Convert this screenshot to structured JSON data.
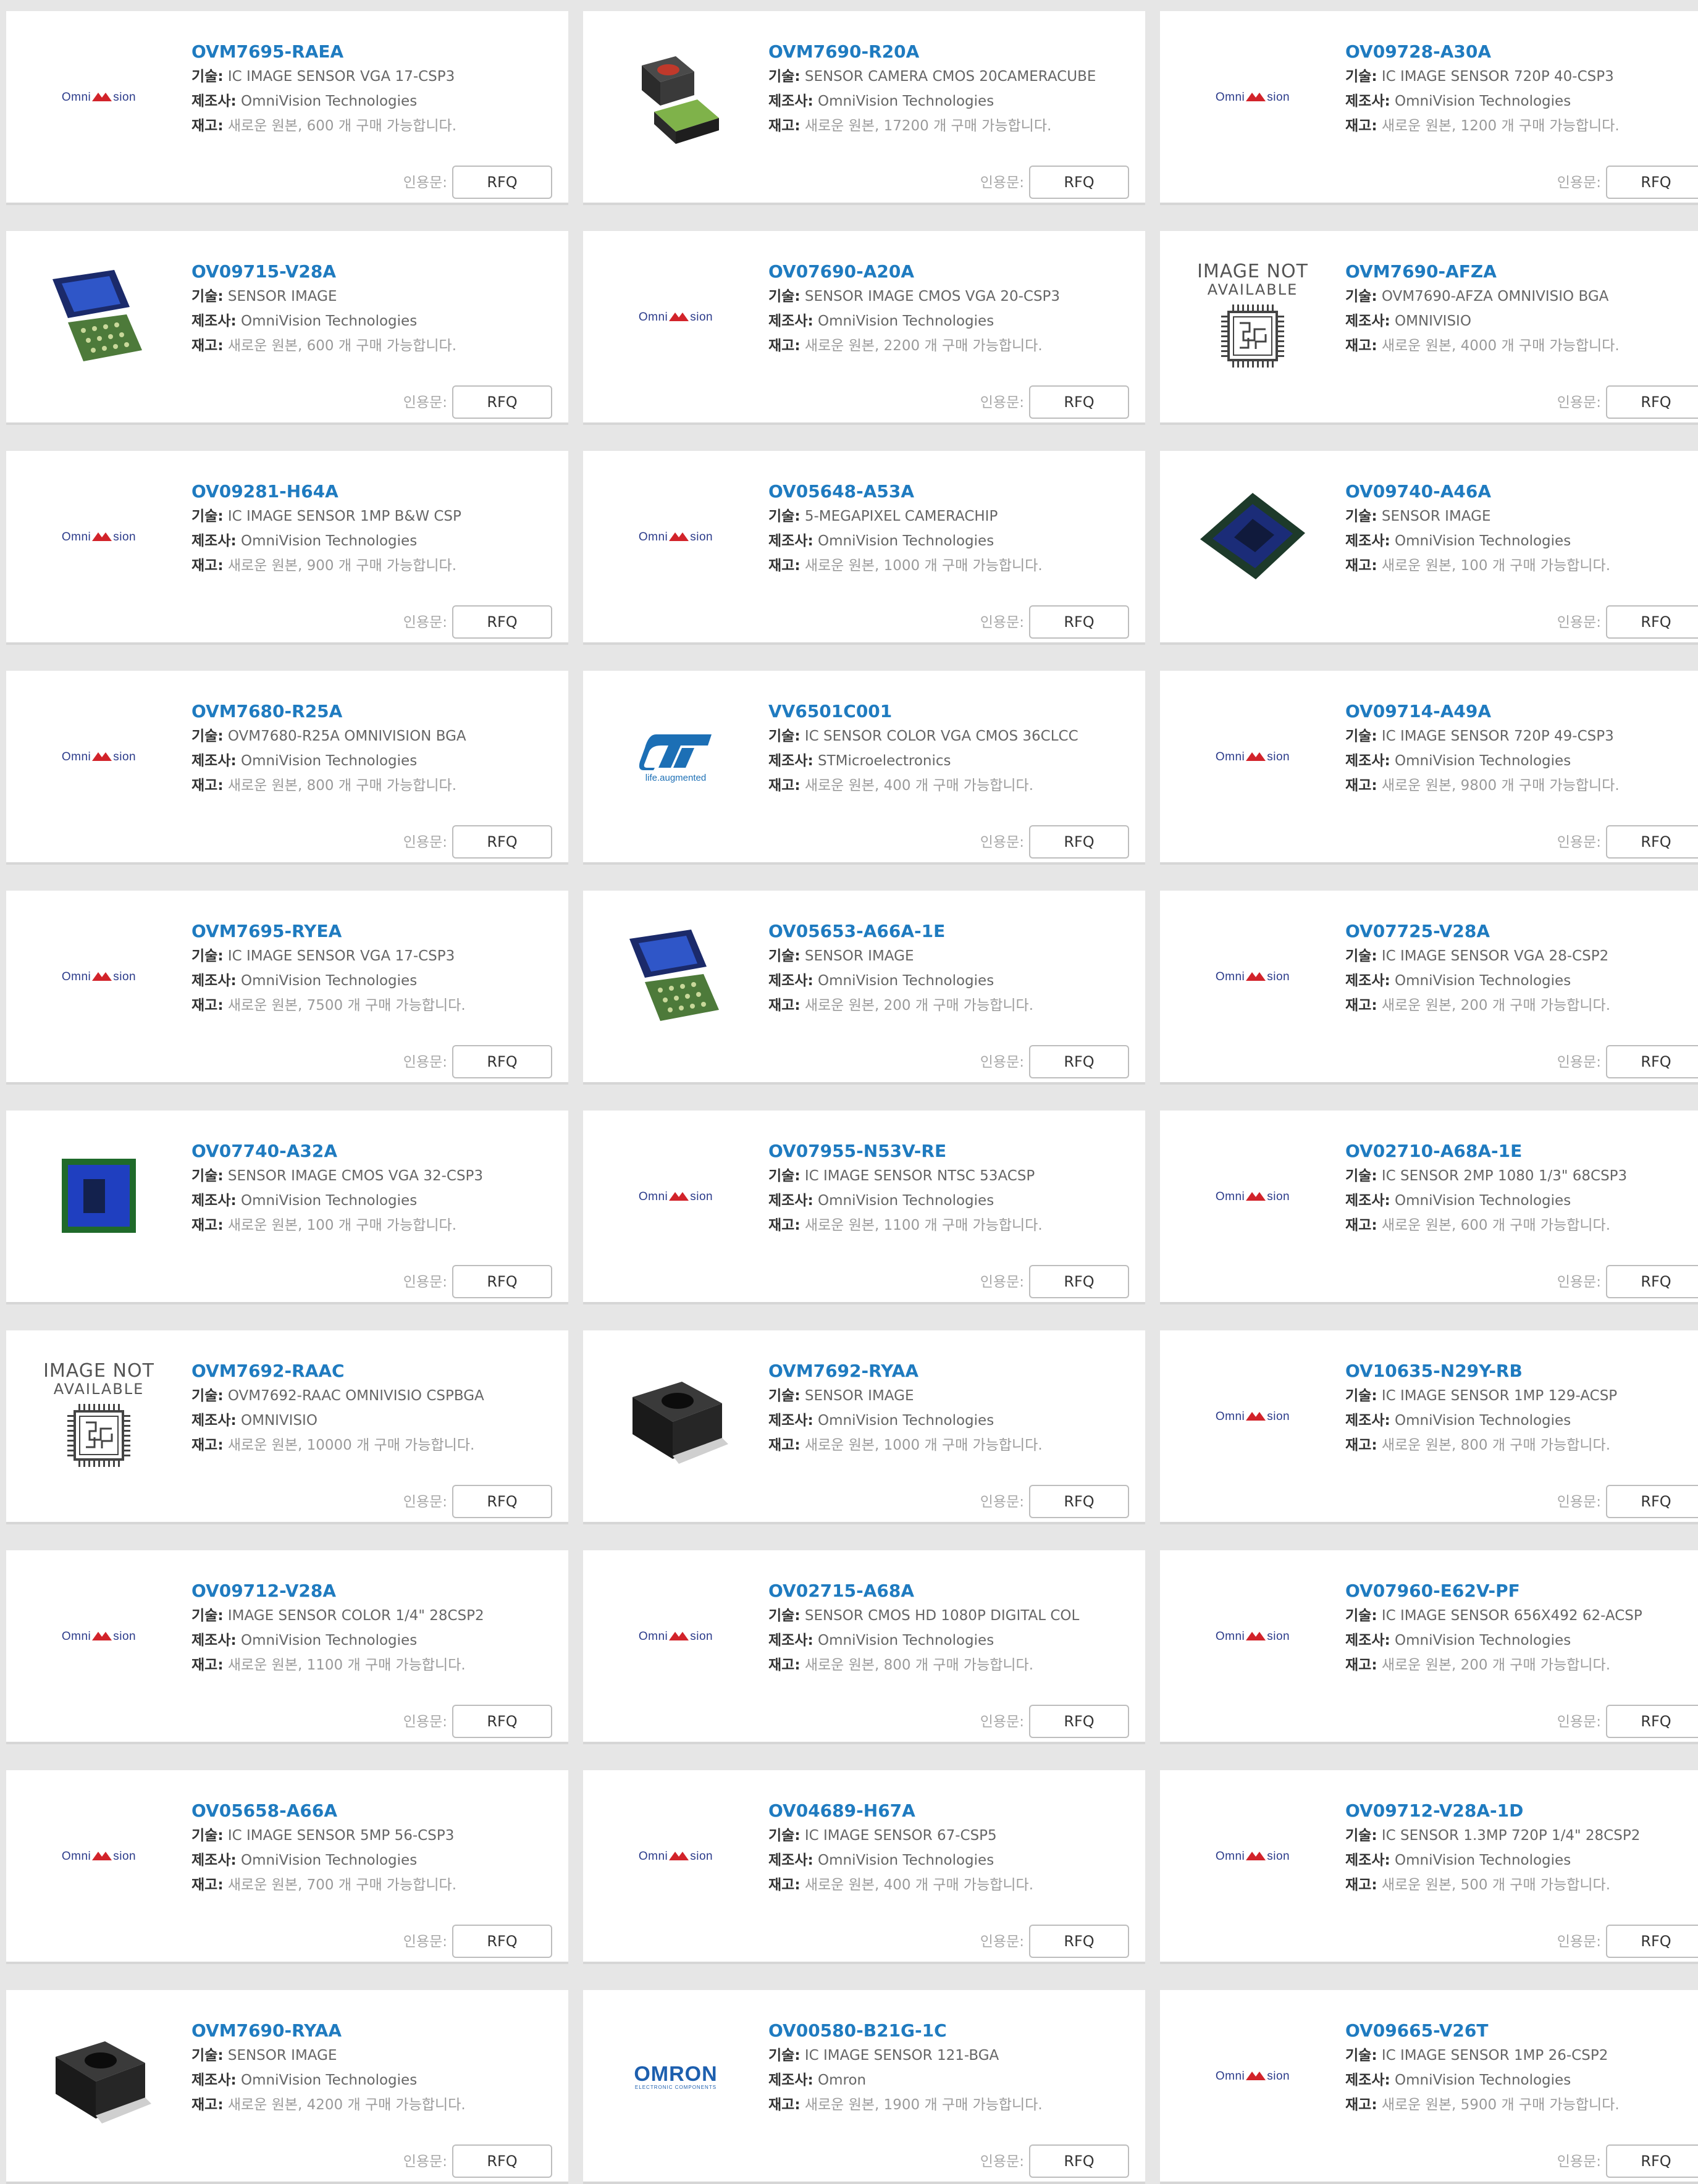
{
  "labels": {
    "tech": "기술:",
    "maker": "제조사:",
    "stock": "재고:",
    "quote": "인용문:",
    "rfq": "RFQ",
    "stock_prefix": "새로운 원본,",
    "stock_suffix": "개 구매 가능합니다.",
    "image_not_available_1": "IMAGE NOT",
    "image_not_available_2": "AVAILABLE",
    "st_tagline": "life.augmented",
    "omron_main": "OMRON",
    "omron_sub": "ELECTRONIC COMPONENTS",
    "omnivision_logo": "OmniVision"
  },
  "products": [
    {
      "part": "OVM7695-RAEA",
      "tech": "IC IMAGE SENSOR VGA 17-CSP3",
      "maker": "OmniVision Technologies",
      "qty": "600",
      "image": "omnivision-logo"
    },
    {
      "part": "OVM7690-R20A",
      "tech": "SENSOR CAMERA CMOS 20CAMERACUBE",
      "maker": "OmniVision Technologies",
      "qty": "17200",
      "image": "camera-cube-chip"
    },
    {
      "part": "OV09728-A30A",
      "tech": "IC IMAGE SENSOR 720P 40-CSP3",
      "maker": "OmniVision Technologies",
      "qty": "1200",
      "image": "omnivision-logo"
    },
    {
      "part": "OV09715-V28A",
      "tech": "SENSOR IMAGE",
      "maker": "OmniVision Technologies",
      "qty": "600",
      "image": "sensor-bga-pair"
    },
    {
      "part": "OV07690-A20A",
      "tech": "SENSOR IMAGE CMOS VGA 20-CSP3",
      "maker": "OmniVision Technologies",
      "qty": "2200",
      "image": "omnivision-logo"
    },
    {
      "part": "OVM7690-AFZA",
      "tech": "OVM7690-AFZA OMNIVISIO BGA",
      "maker": "OMNIVISIO",
      "qty": "4000",
      "image": "image-not-available"
    },
    {
      "part": "OV09281-H64A",
      "tech": "IC IMAGE SENSOR 1MP B&W CSP",
      "maker": "OmniVision Technologies",
      "qty": "900",
      "image": "omnivision-logo"
    },
    {
      "part": "OV05648-A53A",
      "tech": "5-MEGAPIXEL CAMERACHIP",
      "maker": "OmniVision Technologies",
      "qty": "1000",
      "image": "omnivision-logo"
    },
    {
      "part": "OV09740-A46A",
      "tech": "SENSOR IMAGE",
      "maker": "OmniVision Technologies",
      "qty": "100",
      "image": "sensor-diamond"
    },
    {
      "part": "OVM7680-R25A",
      "tech": "OVM7680-R25A OMNIVISION BGA",
      "maker": "OmniVision Technologies",
      "qty": "800",
      "image": "omnivision-logo"
    },
    {
      "part": "VV6501C001",
      "tech": "IC SENSOR COLOR VGA CMOS 36CLCC",
      "maker": "STMicroelectronics",
      "qty": "400",
      "image": "st-logo"
    },
    {
      "part": "OV09714-A49A",
      "tech": "IC IMAGE SENSOR 720P 49-CSP3",
      "maker": "OmniVision Technologies",
      "qty": "9800",
      "image": "omnivision-logo"
    },
    {
      "part": "OVM7695-RYEA",
      "tech": "IC IMAGE SENSOR VGA 17-CSP3",
      "maker": "OmniVision Technologies",
      "qty": "7500",
      "image": "omnivision-logo"
    },
    {
      "part": "OV05653-A66A-1E",
      "tech": "SENSOR IMAGE",
      "maker": "OmniVision Technologies",
      "qty": "200",
      "image": "sensor-bga-pair"
    },
    {
      "part": "OV07725-V28A",
      "tech": "IC IMAGE SENSOR VGA 28-CSP2",
      "maker": "OmniVision Technologies",
      "qty": "200",
      "image": "omnivision-logo"
    },
    {
      "part": "OV07740-A32A",
      "tech": "SENSOR IMAGE CMOS VGA 32-CSP3",
      "maker": "OmniVision Technologies",
      "qty": "100",
      "image": "sensor-square"
    },
    {
      "part": "OV07955-N53V-RE",
      "tech": "IC IMAGE SENSOR NTSC 53ACSP",
      "maker": "OmniVision Technologies",
      "qty": "1100",
      "image": "omnivision-logo"
    },
    {
      "part": "OV02710-A68A-1E",
      "tech": "IC SENSOR 2MP 1080 1/3\" 68CSP3",
      "maker": "OmniVision Technologies",
      "qty": "600",
      "image": "omnivision-logo"
    },
    {
      "part": "OVM7692-RAAC",
      "tech": "OVM7692-RAAC OMNIVISIO CSPBGA",
      "maker": "OMNIVISIO",
      "qty": "10000",
      "image": "image-not-available"
    },
    {
      "part": "OVM7692-RYAA",
      "tech": "SENSOR IMAGE",
      "maker": "OmniVision Technologies",
      "qty": "1000",
      "image": "camera-module"
    },
    {
      "part": "OV10635-N29Y-RB",
      "tech": "IC IMAGE SENSOR 1MP 129-ACSP",
      "maker": "OmniVision Technologies",
      "qty": "800",
      "image": "omnivision-logo"
    },
    {
      "part": "OV09712-V28A",
      "tech": "IMAGE SENSOR COLOR 1/4\" 28CSP2",
      "maker": "OmniVision Technologies",
      "qty": "1100",
      "image": "omnivision-logo"
    },
    {
      "part": "OV02715-A68A",
      "tech": "SENSOR CMOS HD 1080P DIGITAL COL",
      "maker": "OmniVision Technologies",
      "qty": "800",
      "image": "omnivision-logo"
    },
    {
      "part": "OV07960-E62V-PF",
      "tech": "IC IMAGE SENSOR 656X492 62-ACSP",
      "maker": "OmniVision Technologies",
      "qty": "200",
      "image": "omnivision-logo"
    },
    {
      "part": "OV05658-A66A",
      "tech": "IC IMAGE SENSOR 5MP 56-CSP3",
      "maker": "OmniVision Technologies",
      "qty": "700",
      "image": "omnivision-logo"
    },
    {
      "part": "OV04689-H67A",
      "tech": "IC IMAGE SENSOR 67-CSP5",
      "maker": "OmniVision Technologies",
      "qty": "400",
      "image": "omnivision-logo"
    },
    {
      "part": "OV09712-V28A-1D",
      "tech": "IC SENSOR 1.3MP 720P 1/4\" 28CSP2",
      "maker": "OmniVision Technologies",
      "qty": "500",
      "image": "omnivision-logo"
    },
    {
      "part": "OVM7690-RYAA",
      "tech": "SENSOR IMAGE",
      "maker": "OmniVision Technologies",
      "qty": "4200",
      "image": "camera-module"
    },
    {
      "part": "OV00580-B21G-1C",
      "tech": "IC IMAGE SENSOR 121-BGA",
      "maker": "Omron",
      "qty": "1900",
      "image": "omron-logo"
    },
    {
      "part": "OV09665-V26T",
      "tech": "IC IMAGE SENSOR 1MP 26-CSP2",
      "maker": "OmniVision Technologies",
      "qty": "5900",
      "image": "omnivision-logo"
    }
  ],
  "colors": {
    "part_link": "#1f7bc0",
    "background": "#e6e6e6",
    "card": "#ffffff"
  }
}
